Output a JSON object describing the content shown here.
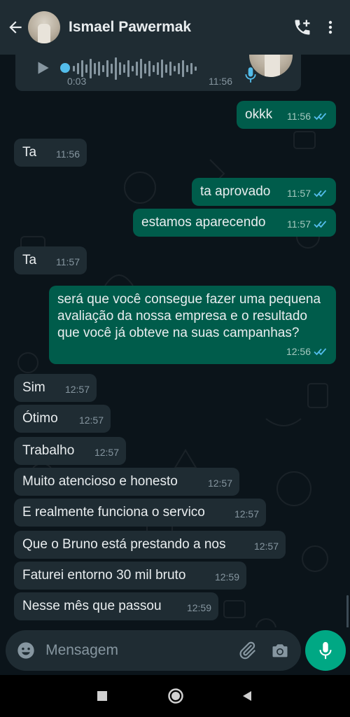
{
  "header": {
    "contact_name": "Ismael Pawermak",
    "icons": [
      "back-arrow-icon",
      "add-call-icon",
      "more-vert-icon"
    ]
  },
  "audio_message": {
    "duration": "0:03",
    "time": "11:56"
  },
  "messages": [
    {
      "dir": "out",
      "text": "okkk",
      "time": "11:56",
      "read": true
    },
    {
      "dir": "in",
      "text": "Ta",
      "time": "11:56"
    },
    {
      "dir": "out",
      "text": "ta aprovado",
      "time": "11:57",
      "read": true
    },
    {
      "dir": "out",
      "text": "estamos aparecendo",
      "time": "11:57",
      "read": true
    },
    {
      "dir": "in",
      "text": "Ta",
      "time": "11:57"
    },
    {
      "dir": "out",
      "text": "será que você consegue fazer uma pequena avaliação da nossa empresa e o resultado que você já obteve na suas campanhas?",
      "time": "12:56",
      "read": true
    },
    {
      "dir": "in",
      "text": "Sim",
      "time": "12:57"
    },
    {
      "dir": "in",
      "text": "Ótimo",
      "time": "12:57"
    },
    {
      "dir": "in",
      "text": "Trabalho",
      "time": "12:57"
    },
    {
      "dir": "in",
      "text": "Muito atencioso e honesto",
      "time": "12:57"
    },
    {
      "dir": "in",
      "text": "E realmente funciona o servico",
      "time": "12:57"
    },
    {
      "dir": "in",
      "text": "Que o Bruno está prestando a nos",
      "time": "12:57"
    },
    {
      "dir": "in",
      "text": "Faturei entorno 30 mil bruto",
      "time": "12:59"
    },
    {
      "dir": "in",
      "text": "Nesse mês que passou",
      "time": "12:59"
    }
  ],
  "input": {
    "placeholder": "Mensagem"
  },
  "colors": {
    "header_bg": "#1f2c33",
    "chat_bg": "#0b141a",
    "incoming_bubble": "#1f2c33",
    "outgoing_bubble": "#005c4b",
    "accent": "#00a884",
    "read_ticks": "#53bdeb"
  }
}
